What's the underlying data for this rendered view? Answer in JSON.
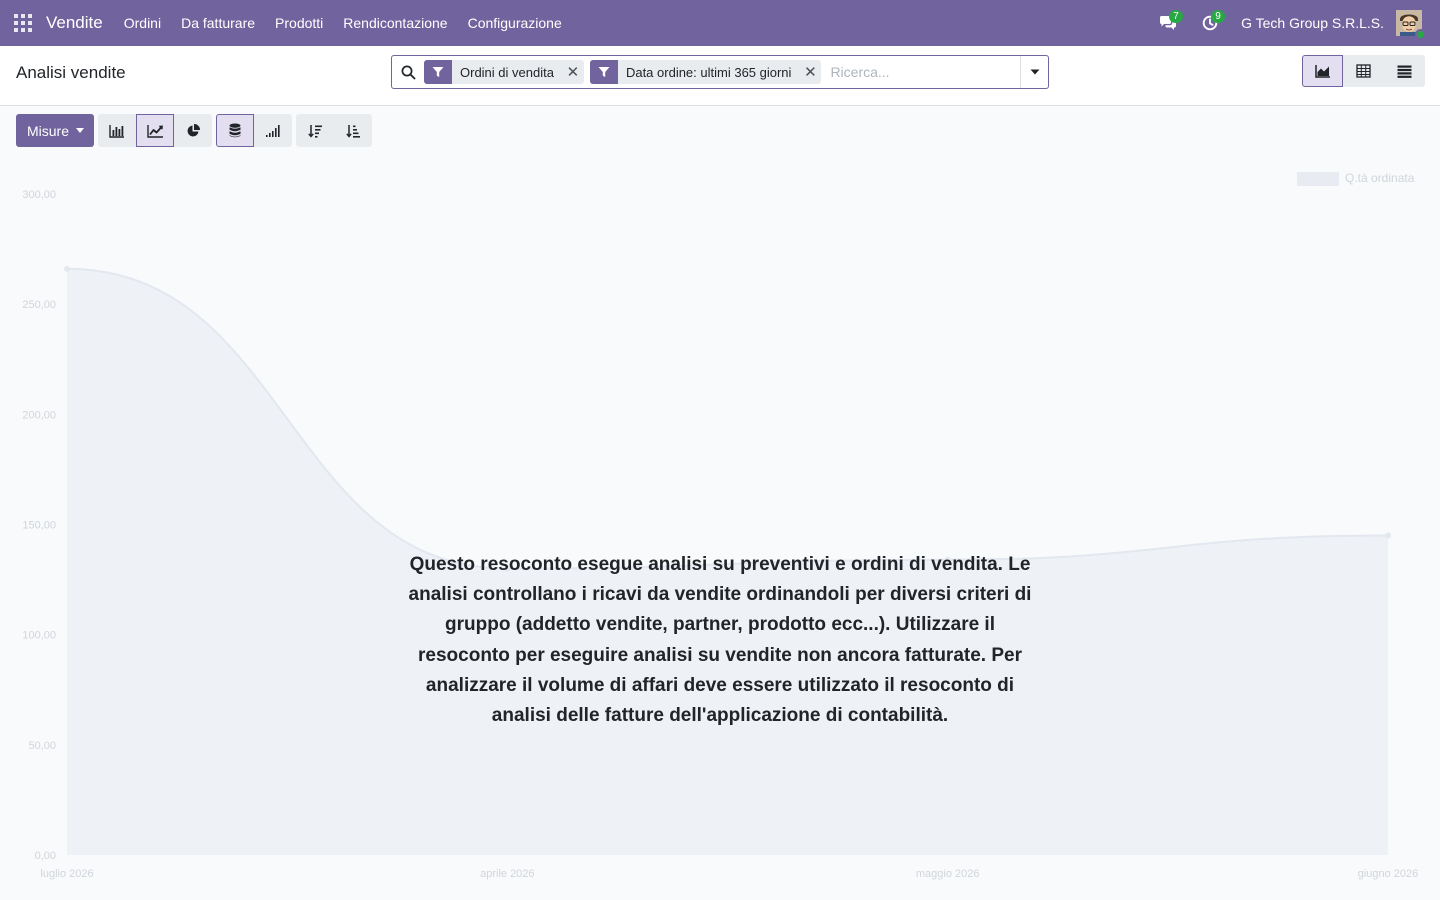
{
  "navbar": {
    "app_name": "Vendite",
    "menu": [
      "Ordini",
      "Da fatturare",
      "Prodotti",
      "Rendicontazione",
      "Configurazione"
    ],
    "messages_count": "7",
    "activities_count": "9",
    "company": "G Tech Group S.R.L.S."
  },
  "control_panel": {
    "title": "Analisi vendite",
    "facets": [
      "Ordini di vendita",
      "Data ordine: ultimi 365 giorni"
    ],
    "search_placeholder": "Ricerca..."
  },
  "toolbar": {
    "measures_label": "Misure"
  },
  "help": {
    "text": "Questo resoconto esegue analisi su preventivi e ordini di vendita. Le analisi controllano i ricavi da vendite ordinandoli per diversi criteri di gruppo (addetto vendite, partner, prodotto ecc...). Utilizzare il resoconto per eseguire analisi su vendite non ancora fatturate. Per analizzare il volume di affari deve essere utilizzato il resoconto di analisi delle fatture dell'applicazione di contabilità."
  },
  "chart_data": {
    "type": "area",
    "categories": [
      "luglio 2026",
      "aprile 2026",
      "maggio 2026",
      "giugno 2026"
    ],
    "series": [
      {
        "name": "Q.tà ordinata",
        "values": [
          266,
          130,
          134,
          145
        ]
      }
    ],
    "yticks": [
      "0,00",
      "50,00",
      "100,00",
      "150,00",
      "200,00",
      "250,00",
      "300,00"
    ],
    "ylim": [
      0,
      300
    ],
    "legend_position": "top-right",
    "color": "#e3e8f0"
  }
}
